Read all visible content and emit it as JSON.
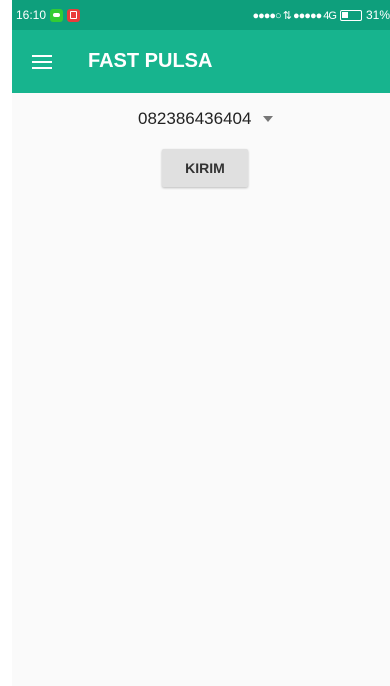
{
  "statusbar": {
    "time": "16:10",
    "signal_text": "●●●●○ ⇅ ●●●●● 4G",
    "battery": "31%"
  },
  "appbar": {
    "title": "FAST PULSA"
  },
  "main": {
    "selected_number": "082386436404",
    "send_label": "KIRIM"
  },
  "colors": {
    "statusbar": "#0e9f7c",
    "appbar": "#17b48e",
    "background": "#fafafa",
    "button": "#e0e0e0"
  }
}
